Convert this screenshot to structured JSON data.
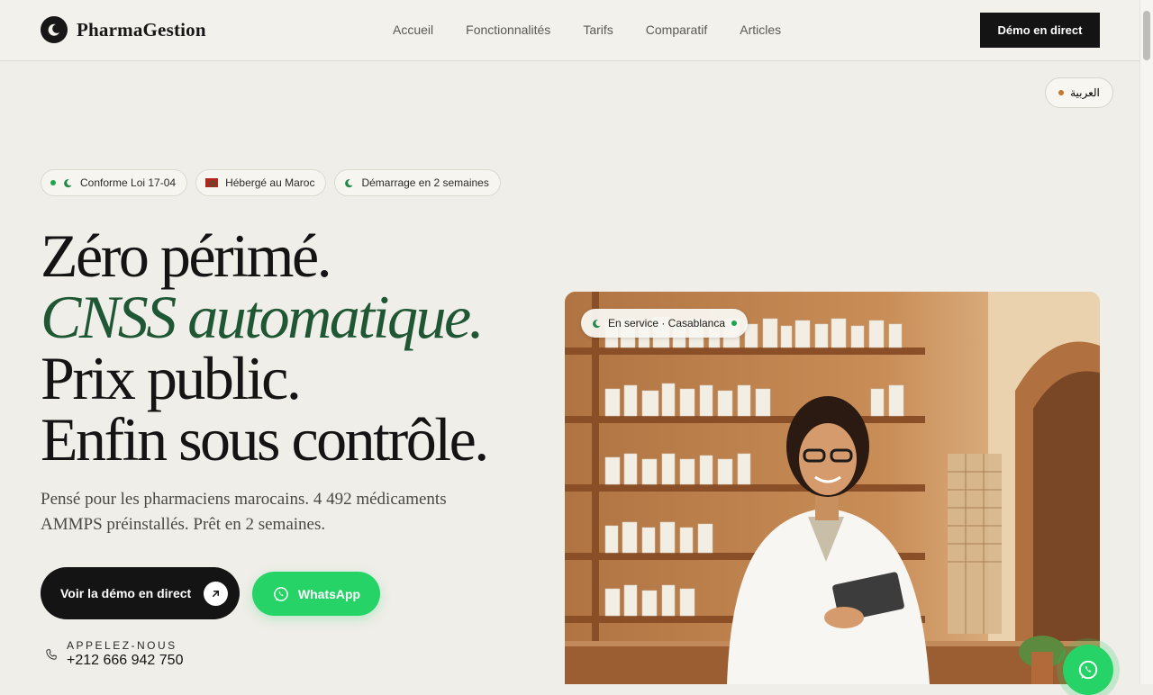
{
  "brand": {
    "name": "PharmaGestion"
  },
  "nav": {
    "items": [
      "Accueil",
      "Fonctionnalités",
      "Tarifs",
      "Comparatif",
      "Articles"
    ]
  },
  "header": {
    "demo_button": "Démo en direct"
  },
  "language": {
    "label": "العربية",
    "dot_color": "#c7762e"
  },
  "badges": [
    {
      "label": "Conforme Loi 17-04"
    },
    {
      "label": "Hébergé au Maroc"
    },
    {
      "label": "Démarrage en 2 semaines"
    }
  ],
  "hero": {
    "lines": [
      "Zéro périmé.",
      "CNSS automatique.",
      "Prix public.",
      "Enfin sous contrôle."
    ],
    "subtitle": "Pensé pour les pharmaciens marocains. 4 492 médicaments AMMPS préinstallés. Prêt en 2 semaines.",
    "cta_demo": "Voir la démo en direct",
    "cta_whatsapp": "WhatsApp",
    "call_label": "APPELEZ-NOUS",
    "call_number": "+212 666 942 750"
  },
  "photo": {
    "status_label": "En service · Casablanca"
  },
  "colors": {
    "accent_green": "#1f5734",
    "whatsapp": "#25d366",
    "dark": "#141414"
  },
  "icons": [
    "moon-logo-icon",
    "moon-icon",
    "morocco-flag-icon",
    "arrow-up-right-icon",
    "whatsapp-icon",
    "phone-icon"
  ]
}
